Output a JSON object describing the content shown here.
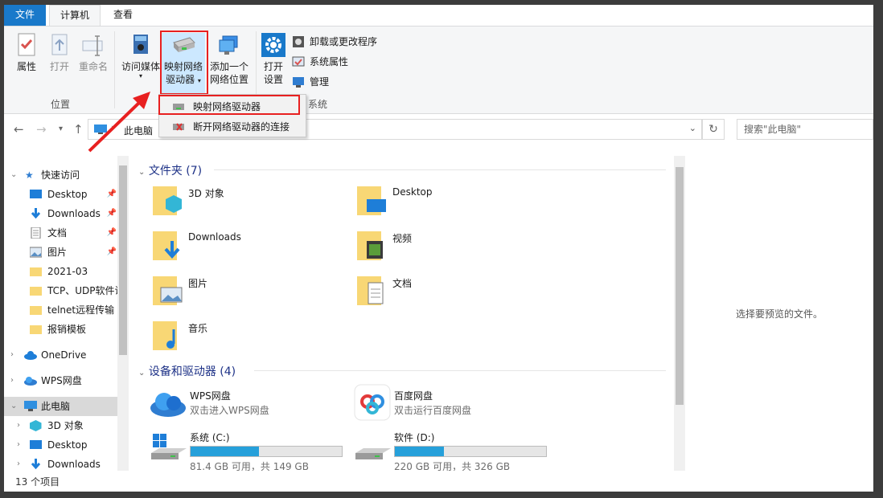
{
  "tabs": {
    "file": "文件",
    "computer": "计算机",
    "view": "查看"
  },
  "ribbon": {
    "properties": "属性",
    "open": "打开",
    "rename": "重命名",
    "access_media": "访问媒体",
    "map_drive_line1": "映射网络",
    "map_drive_line2": "驱动器",
    "add_location_line1": "添加一个",
    "add_location_line2": "网络位置",
    "open_settings_line1": "打开",
    "open_settings_line2": "设置",
    "uninstall": "卸载或更改程序",
    "system_props": "系统属性",
    "manage": "管理",
    "group_location": "位置",
    "group_system": "系统"
  },
  "dropdown": {
    "map_drive": "映射网络驱动器",
    "disconnect": "断开网络驱动器的连接"
  },
  "address": {
    "path": "此电脑",
    "search_placeholder": "搜索\"此电脑\""
  },
  "nav": {
    "quick_access": "快速访问",
    "items": [
      "Desktop",
      "Downloads",
      "文档",
      "图片",
      "2021-03",
      "TCP、UDP软件说",
      "telnet远程传输",
      "报销模板"
    ],
    "onedrive": "OneDrive",
    "wps": "WPS网盘",
    "this_pc": "此电脑",
    "pc_items": [
      "3D 对象",
      "Desktop",
      "Downloads"
    ]
  },
  "content": {
    "folders_title": "文件夹 (7)",
    "folders": [
      "3D 对象",
      "Desktop",
      "Downloads",
      "视频",
      "图片",
      "文档",
      "音乐"
    ],
    "devices_title": "设备和驱动器 (4)",
    "wps_name": "WPS网盘",
    "wps_sub": "双击进入WPS网盘",
    "baidu_name": "百度网盘",
    "baidu_sub": "双击运行百度网盘",
    "drive_c": {
      "name": "系统 (C:)",
      "free": "81.4 GB 可用，共 149 GB",
      "used_fraction": 0.454
    },
    "drive_d": {
      "name": "软件 (D:)",
      "free": "220 GB 可用，共 326 GB",
      "used_fraction": 0.325
    }
  },
  "preview": {
    "text": "选择要预览的文件。"
  },
  "status": {
    "count": "13 个项目"
  },
  "colors": {
    "accent": "#1979ca",
    "highlight": "#e82020",
    "bar": "#26a0da",
    "folder": "#f8d775"
  }
}
